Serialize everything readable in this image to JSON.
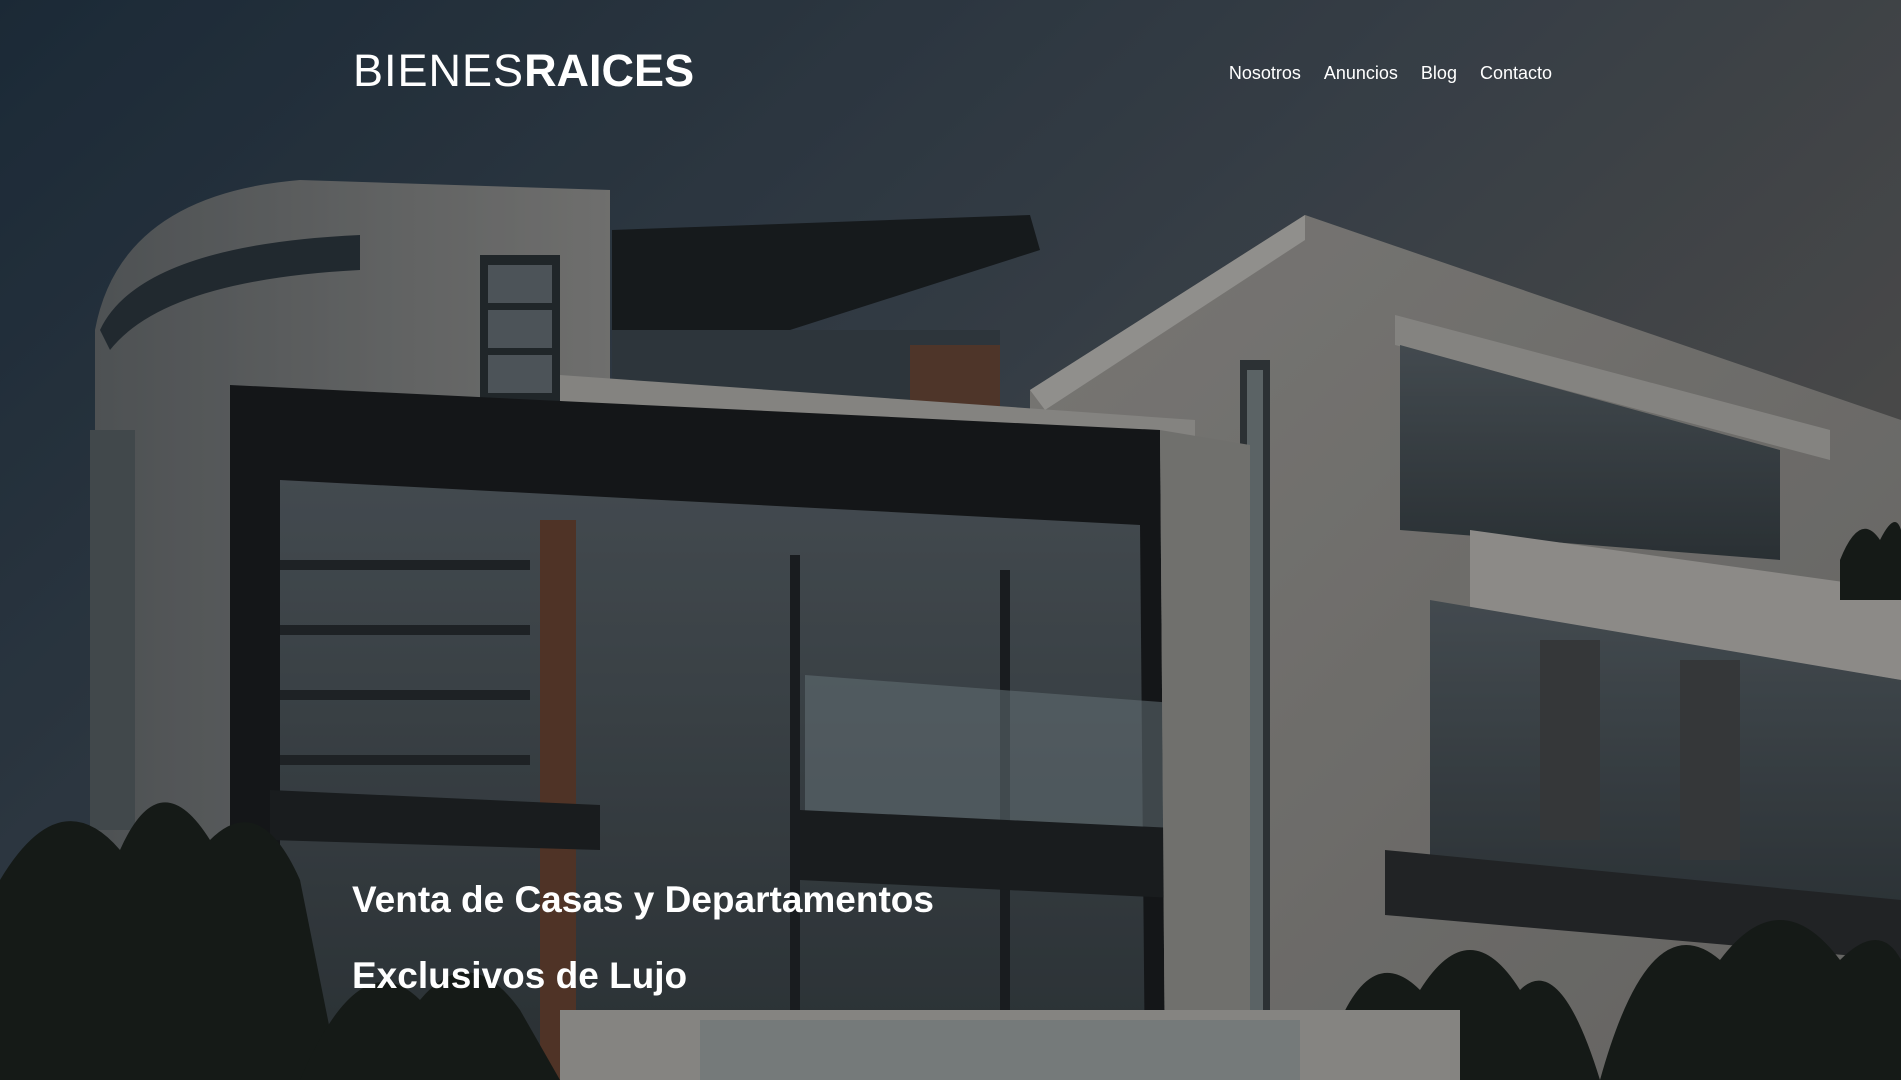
{
  "header": {
    "logo_light": "BIENES",
    "logo_bold": "RAICES"
  },
  "nav": {
    "items": [
      {
        "label": "Nosotros"
      },
      {
        "label": "Anuncios"
      },
      {
        "label": "Blog"
      },
      {
        "label": "Contacto"
      }
    ]
  },
  "hero": {
    "headline_line1": "Venta de Casas y Departamentos",
    "headline_line2": "Exclusivos de Lujo",
    "image_subject": "modern-houses-photo"
  },
  "colors": {
    "text": "#ffffff",
    "sky_top": "#2d3e4e",
    "sky_right": "#5a5a58"
  }
}
